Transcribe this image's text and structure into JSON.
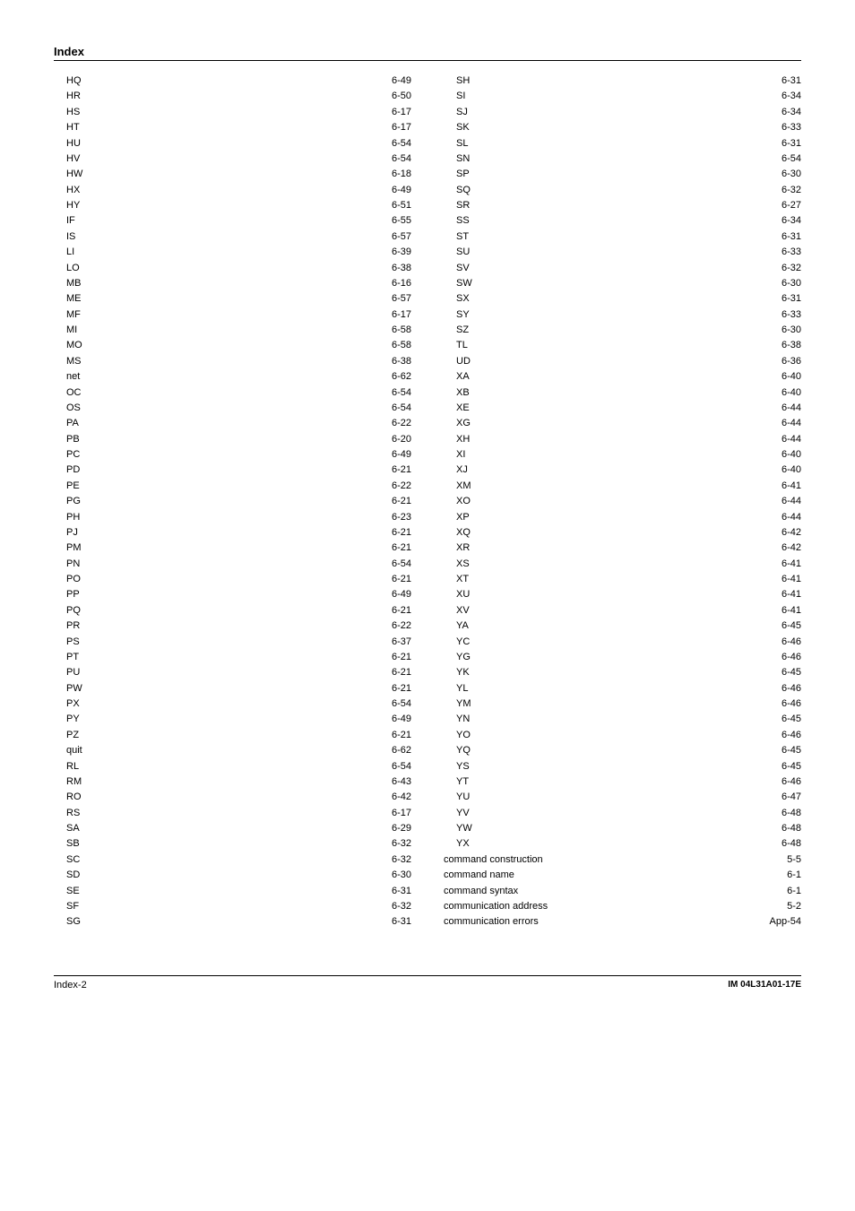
{
  "header": {
    "title": "Index"
  },
  "footer": {
    "left": "Index-2",
    "right": "IM 04L31A01-17E"
  },
  "left_entries": [
    {
      "term": "HQ",
      "page": "6-49",
      "indent": true
    },
    {
      "term": "HR",
      "page": "6-50",
      "indent": true
    },
    {
      "term": "HS",
      "page": "6-17",
      "indent": true
    },
    {
      "term": "HT",
      "page": "6-17",
      "indent": true
    },
    {
      "term": "HU",
      "page": "6-54",
      "indent": true
    },
    {
      "term": "HV",
      "page": "6-54",
      "indent": true
    },
    {
      "term": "HW",
      "page": "6-18",
      "indent": true
    },
    {
      "term": "HX",
      "page": "6-49",
      "indent": true
    },
    {
      "term": "HY",
      "page": "6-51",
      "indent": true
    },
    {
      "term": "IF",
      "page": "6-55",
      "indent": true
    },
    {
      "term": "IS",
      "page": "6-57",
      "indent": true
    },
    {
      "term": "LI",
      "page": "6-39",
      "indent": true
    },
    {
      "term": "LO",
      "page": "6-38",
      "indent": true
    },
    {
      "term": "MB",
      "page": "6-16",
      "indent": true
    },
    {
      "term": "ME",
      "page": "6-57",
      "indent": true
    },
    {
      "term": "MF",
      "page": "6-17",
      "indent": true
    },
    {
      "term": "MI",
      "page": "6-58",
      "indent": true
    },
    {
      "term": "MO",
      "page": "6-58",
      "indent": true
    },
    {
      "term": "MS",
      "page": "6-38",
      "indent": true
    },
    {
      "term": "net",
      "page": "6-62",
      "indent": true
    },
    {
      "term": "OC",
      "page": "6-54",
      "indent": true
    },
    {
      "term": "OS",
      "page": "6-54",
      "indent": true
    },
    {
      "term": "PA",
      "page": "6-22",
      "indent": true
    },
    {
      "term": "PB",
      "page": "6-20",
      "indent": true
    },
    {
      "term": "PC",
      "page": "6-49",
      "indent": true
    },
    {
      "term": "PD",
      "page": "6-21",
      "indent": true
    },
    {
      "term": "PE",
      "page": "6-22",
      "indent": true
    },
    {
      "term": "PG",
      "page": "6-21",
      "indent": true
    },
    {
      "term": "PH",
      "page": "6-23",
      "indent": true
    },
    {
      "term": "PJ",
      "page": "6-21",
      "indent": true
    },
    {
      "term": "PM",
      "page": "6-21",
      "indent": true
    },
    {
      "term": "PN",
      "page": "6-54",
      "indent": true
    },
    {
      "term": "PO",
      "page": "6-21",
      "indent": true
    },
    {
      "term": "PP",
      "page": "6-49",
      "indent": true
    },
    {
      "term": "PQ",
      "page": "6-21",
      "indent": true
    },
    {
      "term": "PR",
      "page": "6-22",
      "indent": true
    },
    {
      "term": "PS",
      "page": "6-37",
      "indent": true
    },
    {
      "term": "PT",
      "page": "6-21",
      "indent": true
    },
    {
      "term": "PU",
      "page": "6-21",
      "indent": true
    },
    {
      "term": "PW",
      "page": "6-21",
      "indent": true
    },
    {
      "term": "PX",
      "page": "6-54",
      "indent": true
    },
    {
      "term": "PY",
      "page": "6-49",
      "indent": true
    },
    {
      "term": "PZ",
      "page": "6-21",
      "indent": true
    },
    {
      "term": "quit",
      "page": "6-62",
      "indent": true
    },
    {
      "term": "RL",
      "page": "6-54",
      "indent": true
    },
    {
      "term": "RM",
      "page": "6-43",
      "indent": true
    },
    {
      "term": "RO",
      "page": "6-42",
      "indent": true
    },
    {
      "term": "RS",
      "page": "6-17",
      "indent": true
    },
    {
      "term": "SA",
      "page": "6-29",
      "indent": true
    },
    {
      "term": "SB",
      "page": "6-32",
      "indent": true
    },
    {
      "term": "SC",
      "page": "6-32",
      "indent": true
    },
    {
      "term": "SD",
      "page": "6-30",
      "indent": true
    },
    {
      "term": "SE",
      "page": "6-31",
      "indent": true
    },
    {
      "term": "SF",
      "page": "6-32",
      "indent": true
    },
    {
      "term": "SG",
      "page": "6-31",
      "indent": true
    }
  ],
  "right_entries": [
    {
      "term": "SH",
      "page": "6-31",
      "indent": true
    },
    {
      "term": "SI",
      "page": "6-34",
      "indent": true
    },
    {
      "term": "SJ",
      "page": "6-34",
      "indent": true
    },
    {
      "term": "SK",
      "page": "6-33",
      "indent": true
    },
    {
      "term": "SL",
      "page": "6-31",
      "indent": true
    },
    {
      "term": "SN",
      "page": "6-54",
      "indent": true
    },
    {
      "term": "SP",
      "page": "6-30",
      "indent": true
    },
    {
      "term": "SQ",
      "page": "6-32",
      "indent": true
    },
    {
      "term": "SR",
      "page": "6-27",
      "indent": true
    },
    {
      "term": "SS",
      "page": "6-34",
      "indent": true
    },
    {
      "term": "ST",
      "page": "6-31",
      "indent": true
    },
    {
      "term": "SU",
      "page": "6-33",
      "indent": true
    },
    {
      "term": "SV",
      "page": "6-32",
      "indent": true
    },
    {
      "term": "SW",
      "page": "6-30",
      "indent": true
    },
    {
      "term": "SX",
      "page": "6-31",
      "indent": true
    },
    {
      "term": "SY",
      "page": "6-33",
      "indent": true
    },
    {
      "term": "SZ",
      "page": "6-30",
      "indent": true
    },
    {
      "term": "TL",
      "page": "6-38",
      "indent": true
    },
    {
      "term": "UD",
      "page": "6-36",
      "indent": true
    },
    {
      "term": "XA",
      "page": "6-40",
      "indent": true
    },
    {
      "term": "XB",
      "page": "6-40",
      "indent": true
    },
    {
      "term": "XE",
      "page": "6-44",
      "indent": true
    },
    {
      "term": "XG",
      "page": "6-44",
      "indent": true
    },
    {
      "term": "XH",
      "page": "6-44",
      "indent": true
    },
    {
      "term": "XI",
      "page": "6-40",
      "indent": true
    },
    {
      "term": "XJ",
      "page": "6-40",
      "indent": true
    },
    {
      "term": "XM",
      "page": "6-41",
      "indent": true
    },
    {
      "term": "XO",
      "page": "6-44",
      "indent": true
    },
    {
      "term": "XP",
      "page": "6-44",
      "indent": true
    },
    {
      "term": "XQ",
      "page": "6-42",
      "indent": true
    },
    {
      "term": "XR",
      "page": "6-42",
      "indent": true
    },
    {
      "term": "XS",
      "page": "6-41",
      "indent": true
    },
    {
      "term": "XT",
      "page": "6-41",
      "indent": true
    },
    {
      "term": "XU",
      "page": "6-41",
      "indent": true
    },
    {
      "term": "XV",
      "page": "6-41",
      "indent": true
    },
    {
      "term": "YA",
      "page": "6-45",
      "indent": true
    },
    {
      "term": "YC",
      "page": "6-46",
      "indent": true
    },
    {
      "term": "YG",
      "page": "6-46",
      "indent": true
    },
    {
      "term": "YK",
      "page": "6-45",
      "indent": true
    },
    {
      "term": "YL",
      "page": "6-46",
      "indent": true
    },
    {
      "term": "YM",
      "page": "6-46",
      "indent": true
    },
    {
      "term": "YN",
      "page": "6-45",
      "indent": true
    },
    {
      "term": "YO",
      "page": "6-46",
      "indent": true
    },
    {
      "term": "YQ",
      "page": "6-45",
      "indent": true
    },
    {
      "term": "YS",
      "page": "6-45",
      "indent": true
    },
    {
      "term": "YT",
      "page": "6-46",
      "indent": true
    },
    {
      "term": "YU",
      "page": "6-47",
      "indent": true
    },
    {
      "term": "YV",
      "page": "6-48",
      "indent": true
    },
    {
      "term": "YW",
      "page": "6-48",
      "indent": true
    },
    {
      "term": "YX",
      "page": "6-48",
      "indent": true
    },
    {
      "term": "command construction",
      "page": "5-5",
      "indent": false
    },
    {
      "term": "command name",
      "page": "6-1",
      "indent": false
    },
    {
      "term": "command syntax",
      "page": "6-1",
      "indent": false
    },
    {
      "term": "communication address",
      "page": "5-2",
      "indent": false
    },
    {
      "term": "communication errors",
      "page": "App-54",
      "indent": false
    }
  ]
}
